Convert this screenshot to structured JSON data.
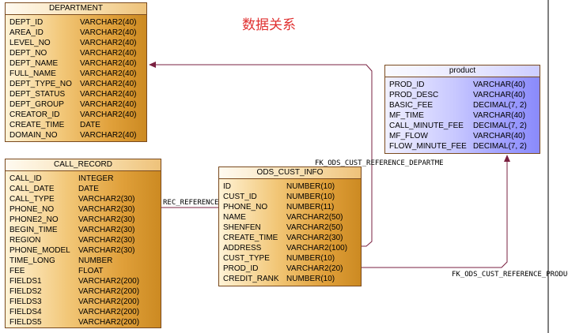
{
  "heading": "数据关系",
  "colors": {
    "table_orange": "#e0a03a",
    "table_blue": "#9c9cff",
    "relation_line": "#7a2040",
    "heading_red": "#e03030"
  },
  "tables": {
    "department": {
      "title": "DEPARTMENT",
      "columns": [
        {
          "name": "DEPT_ID",
          "type": "VARCHAR2(40)"
        },
        {
          "name": "AREA_ID",
          "type": "VARCHAR2(40)"
        },
        {
          "name": "LEVEL_NO",
          "type": "VARCHAR2(40)"
        },
        {
          "name": "DEPT_NO",
          "type": "VARCHAR2(40)"
        },
        {
          "name": "DEPT_NAME",
          "type": "VARCHAR2(40)"
        },
        {
          "name": "FULL_NAME",
          "type": "VARCHAR2(40)"
        },
        {
          "name": "DEPT_TYPE_NO",
          "type": "VARCHAR2(40)"
        },
        {
          "name": "DEPT_STATUS",
          "type": "VARCHAR2(40)"
        },
        {
          "name": "DEPT_GROUP",
          "type": "VARCHAR2(40)"
        },
        {
          "name": "CREATOR_ID",
          "type": "VARCHAR2(40)"
        },
        {
          "name": "CREATE_TIME",
          "type": "DATE"
        },
        {
          "name": "DOMAIN_NO",
          "type": "VARCHAR2(40)"
        }
      ]
    },
    "call_record": {
      "title": "CALL_RECORD",
      "columns": [
        {
          "name": "CALL_ID",
          "type": "INTEGER"
        },
        {
          "name": "CALL_DATE",
          "type": "DATE"
        },
        {
          "name": "CALL_TYPE",
          "type": "VARCHAR2(30)"
        },
        {
          "name": "PHONE_NO",
          "type": "VARCHAR2(30)"
        },
        {
          "name": "PHONE2_NO",
          "type": "VARCHAR2(30)"
        },
        {
          "name": "BEGIN_TIME",
          "type": "VARCHAR2(30)"
        },
        {
          "name": "REGION",
          "type": "VARCHAR2(30)"
        },
        {
          "name": "PHONE_MODEL",
          "type": "VARCHAR2(30)"
        },
        {
          "name": "TIME_LONG",
          "type": "NUMBER"
        },
        {
          "name": "FEE",
          "type": "FLOAT"
        },
        {
          "name": "FIELDS1",
          "type": "VARCHAR2(200)"
        },
        {
          "name": "FIELDS2",
          "type": "VARCHAR2(200)"
        },
        {
          "name": "FIELDS3",
          "type": "VARCHAR2(200)"
        },
        {
          "name": "FIELDS4",
          "type": "VARCHAR2(200)"
        },
        {
          "name": "FIELDS5",
          "type": "VARCHAR2(200)"
        }
      ]
    },
    "ods_cust_info": {
      "title": "ODS_CUST_INFO",
      "columns": [
        {
          "name": "ID",
          "type": "NUMBER(10)"
        },
        {
          "name": "CUST_ID",
          "type": "NUMBER(10)"
        },
        {
          "name": "PHONE_NO",
          "type": "NUMBER(11)"
        },
        {
          "name": "NAME",
          "type": "VARCHAR2(50)"
        },
        {
          "name": "SHENFEN",
          "type": "VARCHAR2(50)"
        },
        {
          "name": "CREATE_TIME",
          "type": "VARCHAR2(30)"
        },
        {
          "name": "ADDRESS",
          "type": "VARCHAR2(100)"
        },
        {
          "name": "CUST_TYPE",
          "type": "NUMBER(10)"
        },
        {
          "name": "PROD_ID",
          "type": "VARCHAR2(20)"
        },
        {
          "name": "CREDIT_RANK",
          "type": "NUMBER(10)"
        }
      ]
    },
    "product": {
      "title": "product",
      "columns": [
        {
          "name": "PROD_ID",
          "type": "VARCHAR(40)"
        },
        {
          "name": "PROD_DESC",
          "type": "VARCHAR(40)"
        },
        {
          "name": "BASIC_FEE",
          "type": "DECIMAL(7, 2)"
        },
        {
          "name": "MF_TIME",
          "type": "VARCHAR(40)"
        },
        {
          "name": "CALL_MINUTE_FEE",
          "type": "DECIMAL(7, 2)"
        },
        {
          "name": "MF_FLOW",
          "type": "VARCHAR(40)"
        },
        {
          "name": "FLOW_MINUTE_FEE",
          "type": "DECIMAL(7, 2)"
        }
      ]
    }
  },
  "references": {
    "department": "FK_ODS_CUST_REFERENCE_DEPARTME",
    "call_record": "REC_REFERENCE_",
    "product": "FK_ODS_CUST_REFERENCE_PRODUCT"
  }
}
